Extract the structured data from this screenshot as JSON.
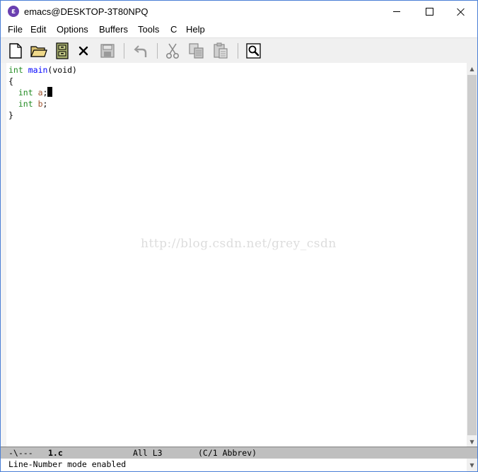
{
  "window": {
    "title": "emacs@DESKTOP-3T80NPQ",
    "app_icon_letter": "ε",
    "border_color": "#4a7fd6"
  },
  "menu": {
    "items": [
      "File",
      "Edit",
      "Options",
      "Buffers",
      "Tools",
      "C",
      "Help"
    ]
  },
  "toolbar": {
    "buttons": [
      "new-file-icon",
      "open-folder-icon",
      "open-dired-icon",
      "close-buffer-icon",
      "save-icon",
      "undo-icon",
      "cut-icon",
      "copy-icon",
      "paste-icon",
      "search-icon"
    ]
  },
  "editor": {
    "lines": [
      {
        "type": "int",
        "rest1": " ",
        "fn": "main",
        "rest2": "(void)"
      },
      {
        "text": "{"
      },
      {
        "indent": "  ",
        "type": "int",
        "space": " ",
        "var": "a",
        "punct": ";"
      },
      {
        "indent": "  ",
        "type": "int",
        "space": " ",
        "var": "b",
        "punct": ";"
      },
      {
        "text": "}"
      }
    ],
    "colors": {
      "type": "#228b22",
      "function": "#0000ff",
      "variable": "#a0522d"
    },
    "watermark": "http://blog.csdn.net/grey_csdn"
  },
  "modeline": {
    "status": "-\\---",
    "buffer": "1.c",
    "position": "All L3",
    "mode": "(C/1 Abbrev)"
  },
  "echo": {
    "message": "Line-Number mode enabled"
  }
}
